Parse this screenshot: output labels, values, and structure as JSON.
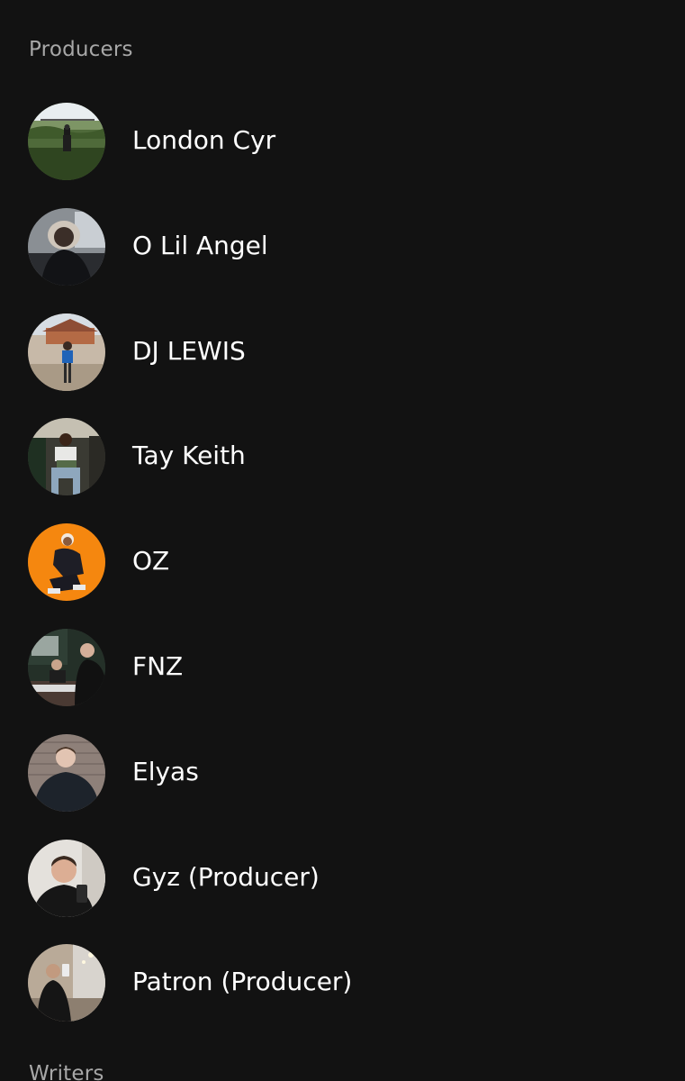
{
  "sections": {
    "producers_title": "Producers",
    "writers_title": "Writers"
  },
  "producers": [
    {
      "name": "London Cyr",
      "avatar": "portrait-field"
    },
    {
      "name": "O Lil Angel",
      "avatar": "portrait-car"
    },
    {
      "name": "DJ LEWIS",
      "avatar": "portrait-house"
    },
    {
      "name": "Tay Keith",
      "avatar": "portrait-studio-seated"
    },
    {
      "name": "OZ",
      "avatar": "portrait-orange"
    },
    {
      "name": "FNZ",
      "avatar": "portrait-studio-duo"
    },
    {
      "name": "Elyas",
      "avatar": "portrait-brickwall"
    },
    {
      "name": "Gyz (Producer)",
      "avatar": "portrait-selfie"
    },
    {
      "name": "Patron (Producer)",
      "avatar": "portrait-mirror-selfie"
    }
  ],
  "colors": {
    "background": "#121212",
    "section_title": "#a7a7a7",
    "name": "#ffffff"
  }
}
